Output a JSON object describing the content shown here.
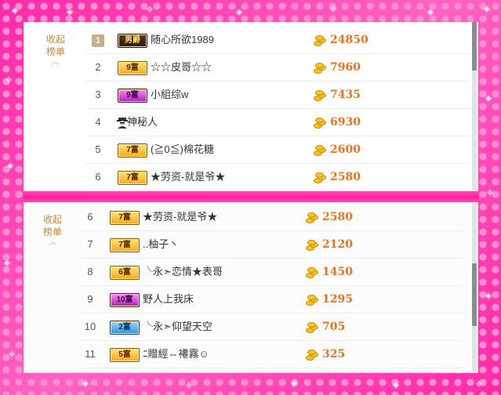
{
  "top_panel": {
    "toggle_label_1": "收起",
    "toggle_label_2": "榜单",
    "rows": [
      {
        "rank": "1",
        "badge": "男爵",
        "badge_style": "black",
        "name": "随心所欲1989",
        "score": "24850"
      },
      {
        "rank": "2",
        "badge": "9富",
        "badge_style": "gold",
        "name": "☆☆皮哥☆☆",
        "score": "7960"
      },
      {
        "rank": "3",
        "badge": "9富",
        "badge_style": "purple",
        "name": "小組综w",
        "score": "7435"
      },
      {
        "rank": "4",
        "badge": "",
        "badge_style": "mystery",
        "name": "神秘人",
        "score": "6930"
      },
      {
        "rank": "5",
        "badge": "7富",
        "badge_style": "gold",
        "name": "(≧0≦)棉花糖",
        "score": "2600"
      },
      {
        "rank": "6",
        "badge": "7富",
        "badge_style": "gold",
        "name": "★劳资-就是爷★",
        "score": "2580"
      }
    ]
  },
  "bottom_panel": {
    "toggle_label_1": "收起",
    "toggle_label_2": "榜单",
    "rows": [
      {
        "rank": "6",
        "badge": "7富",
        "badge_style": "gold",
        "name": "★劳资-就是爷★",
        "score": "2580"
      },
      {
        "rank": "7",
        "badge": "7富",
        "badge_style": "gold",
        "name": "..柚子丶",
        "score": "2120"
      },
      {
        "rank": "8",
        "badge": "6富",
        "badge_style": "gold",
        "name": "╰永➣恋情★表哥",
        "score": "1450"
      },
      {
        "rank": "9",
        "badge": "10富",
        "badge_style": "purple",
        "name": "野人上我床",
        "score": "1295"
      },
      {
        "rank": "10",
        "badge": "2富",
        "badge_style": "blue",
        "name": "╰永➣仰望天空",
        "score": "705"
      },
      {
        "rank": "11",
        "badge": "5富",
        "badge_style": "gold",
        "name": "ﾆ贈經⇔褼霧☺",
        "score": "325"
      }
    ]
  },
  "colors": {
    "frame_pink": "#ff2aa8",
    "score_orange": "#e8731c",
    "toggle_brown": "#c7864a"
  }
}
